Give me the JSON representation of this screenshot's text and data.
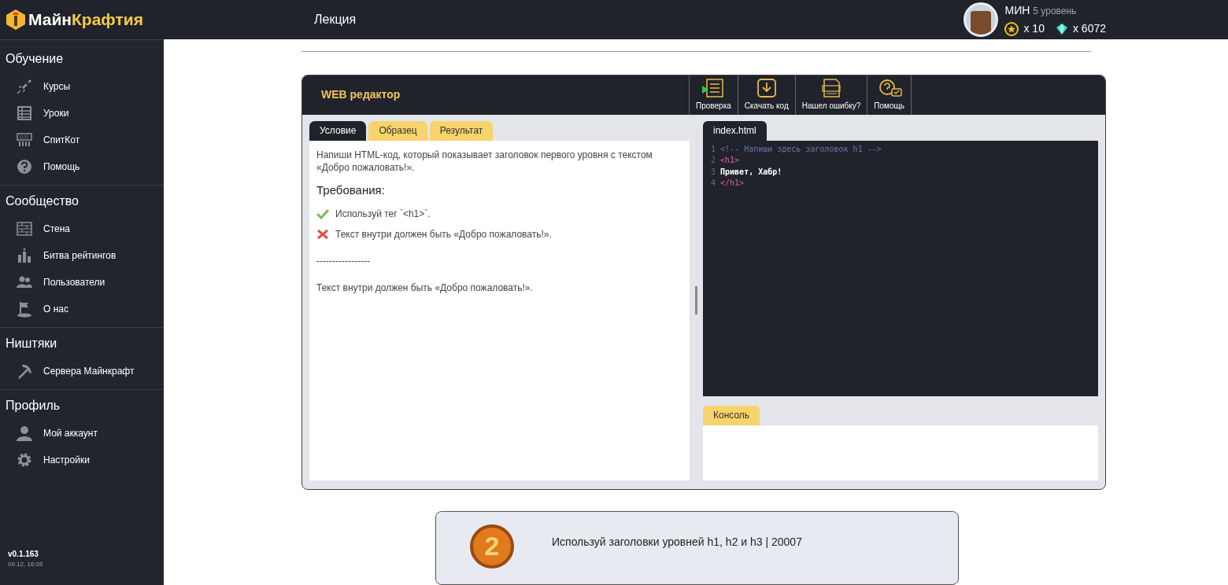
{
  "header": {
    "logo_part_1": "Майн",
    "logo_part_2": "Крафтия",
    "page_title": "Лекция",
    "user": {
      "name": "МИН",
      "level": "5 уровень",
      "stars": "x 10",
      "gems": "x 6072"
    }
  },
  "sidebar": {
    "sections": [
      {
        "title": "Обучение",
        "items": [
          {
            "label": "Курсы",
            "kind": "rocket"
          },
          {
            "label": "Уроки",
            "kind": "table"
          },
          {
            "label": "СпитКот",
            "kind": "keyboard"
          },
          {
            "label": "Помощь",
            "kind": "help"
          }
        ]
      },
      {
        "title": "Сообщество",
        "items": [
          {
            "label": "Стена",
            "kind": "wall"
          },
          {
            "label": "Битва рейтингов",
            "kind": "bars"
          },
          {
            "label": "Пользователи",
            "kind": "users"
          },
          {
            "label": "О нас",
            "kind": "flag"
          }
        ]
      },
      {
        "title": "Ништяки",
        "items": [
          {
            "label": "Сервера Майнкрафт",
            "kind": "pickaxe"
          }
        ]
      },
      {
        "title": "Профиль",
        "items": [
          {
            "label": "Мой аккаунт",
            "kind": "user"
          },
          {
            "label": "Настройки",
            "kind": "gear"
          }
        ]
      }
    ],
    "version": "v0.1.163",
    "build_date": "09.12, 16:05"
  },
  "editor": {
    "title": "WEB редактор",
    "toolbar": [
      {
        "label": "Проверка",
        "kind": "check"
      },
      {
        "label": "Скачать код",
        "kind": "download"
      },
      {
        "label": "Нашел ошибку?",
        "kind": "error"
      },
      {
        "label": "Помощь",
        "kind": "help"
      }
    ],
    "tabs": [
      {
        "label": "Условие",
        "selected": true
      },
      {
        "label": "Образец",
        "selected": false
      },
      {
        "label": "Результат",
        "selected": false
      }
    ],
    "task": "Напиши HTML-код, который показывает заголовок первого уровня с текстом «Добро пожаловать!».",
    "requirements_title": "Требования:",
    "requirements": [
      {
        "text": "Используй тег `<h1>`.",
        "passed": true
      },
      {
        "text": "Текст внутри должен быть «Добро пожаловать!».",
        "passed": false
      }
    ],
    "separator": "-----------------",
    "message": "Текст внутри должен быть «Добро пожаловать!».",
    "file_tab": "index.html",
    "code_lines": [
      {
        "number": "1",
        "text": "<!-- Напиши здесь заголовок h1 -->",
        "kind": "comment"
      },
      {
        "number": "2",
        "text": "<h1>",
        "kind": "tag"
      },
      {
        "number": "3",
        "text": "Привет, Хабр!",
        "kind": "text"
      },
      {
        "number": "4",
        "text": "</h1>",
        "kind": "tag"
      }
    ],
    "console_tab": "Консоль"
  },
  "lesson_card": {
    "badge": "2",
    "title": "Используй заголовки уровней h1, h2 и h3 | 20007"
  }
}
